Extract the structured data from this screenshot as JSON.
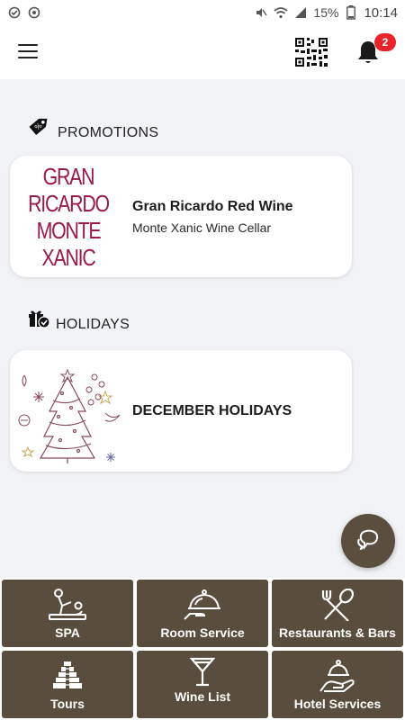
{
  "status_bar": {
    "battery": "15%",
    "time": "10:14"
  },
  "header": {
    "menu_icon": "hamburger-menu-icon",
    "qr_icon": "qr-code-icon",
    "bell_icon": "bell-icon",
    "notification_count": "2",
    "badge_color": "#e8232a"
  },
  "promotions": {
    "title": "PROMOTIONS",
    "icon": "tag-icon",
    "card": {
      "logo_line1": "GRAN RICARDO",
      "logo_line2": "MONTE XANIC",
      "title": "Gran Ricardo Red Wine",
      "subtitle": "Monte Xanic Wine Cellar"
    }
  },
  "holidays": {
    "title": "HOLIDAYS",
    "icon": "gift-icon",
    "card": {
      "title": "DECEMBER HOLIDAYS"
    }
  },
  "chat": {
    "icon": "chat-bubble-icon"
  },
  "menu_tiles": [
    {
      "label": "SPA",
      "icon": "massage-icon"
    },
    {
      "label": "Room Service",
      "icon": "cloche-icon"
    },
    {
      "label": "Restaurants & Bars",
      "icon": "fork-spoon-icon"
    },
    {
      "label": "Tours",
      "icon": "pyramid-icon"
    },
    {
      "label": "Wine List",
      "icon": "wine-glass-icon"
    },
    {
      "label": "Hotel Services",
      "icon": "concierge-hand-icon"
    }
  ],
  "colors": {
    "tile_background": "#594d3e",
    "logo": "#9a1a4e",
    "page_background": "#f2f3f6"
  }
}
